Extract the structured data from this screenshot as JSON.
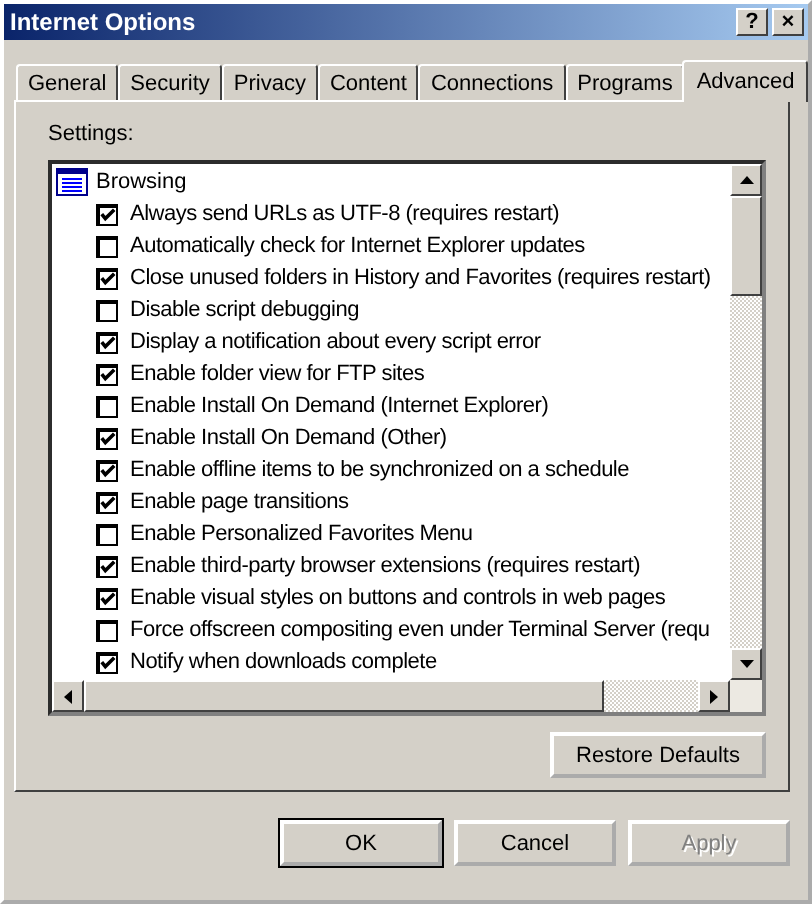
{
  "window": {
    "title": "Internet Options",
    "help_button": "?",
    "close_button": "×"
  },
  "tabs": [
    {
      "label": "General",
      "selected": false
    },
    {
      "label": "Security",
      "selected": false
    },
    {
      "label": "Privacy",
      "selected": false
    },
    {
      "label": "Content",
      "selected": false
    },
    {
      "label": "Connections",
      "selected": false
    },
    {
      "label": "Programs",
      "selected": false
    },
    {
      "label": "Advanced",
      "selected": true
    }
  ],
  "settings_label": "Settings:",
  "settings": {
    "group": "Browsing",
    "items": [
      {
        "label": "Always send URLs as UTF-8 (requires restart)",
        "checked": true
      },
      {
        "label": "Automatically check for Internet Explorer updates",
        "checked": false
      },
      {
        "label": "Close unused folders in History and Favorites (requires restart)",
        "checked": true
      },
      {
        "label": "Disable script debugging",
        "checked": false
      },
      {
        "label": "Display a notification about every script error",
        "checked": true
      },
      {
        "label": "Enable folder view for FTP sites",
        "checked": true
      },
      {
        "label": "Enable Install On Demand (Internet Explorer)",
        "checked": false
      },
      {
        "label": "Enable Install On Demand (Other)",
        "checked": true
      },
      {
        "label": "Enable offline items to be synchronized on a schedule",
        "checked": true
      },
      {
        "label": "Enable page transitions",
        "checked": true
      },
      {
        "label": "Enable Personalized Favorites Menu",
        "checked": false
      },
      {
        "label": "Enable third-party browser extensions (requires restart)",
        "checked": true
      },
      {
        "label": "Enable visual styles on buttons and controls in web pages",
        "checked": true
      },
      {
        "label": "Force offscreen compositing even under Terminal Server (requ",
        "checked": false
      },
      {
        "label": "Notify when downloads complete",
        "checked": true
      }
    ]
  },
  "restore_button": "Restore Defaults",
  "buttons": [
    {
      "label": "OK",
      "disabled": false,
      "default": true
    },
    {
      "label": "Cancel",
      "disabled": false,
      "default": false
    },
    {
      "label": "Apply",
      "disabled": true,
      "default": false
    }
  ]
}
